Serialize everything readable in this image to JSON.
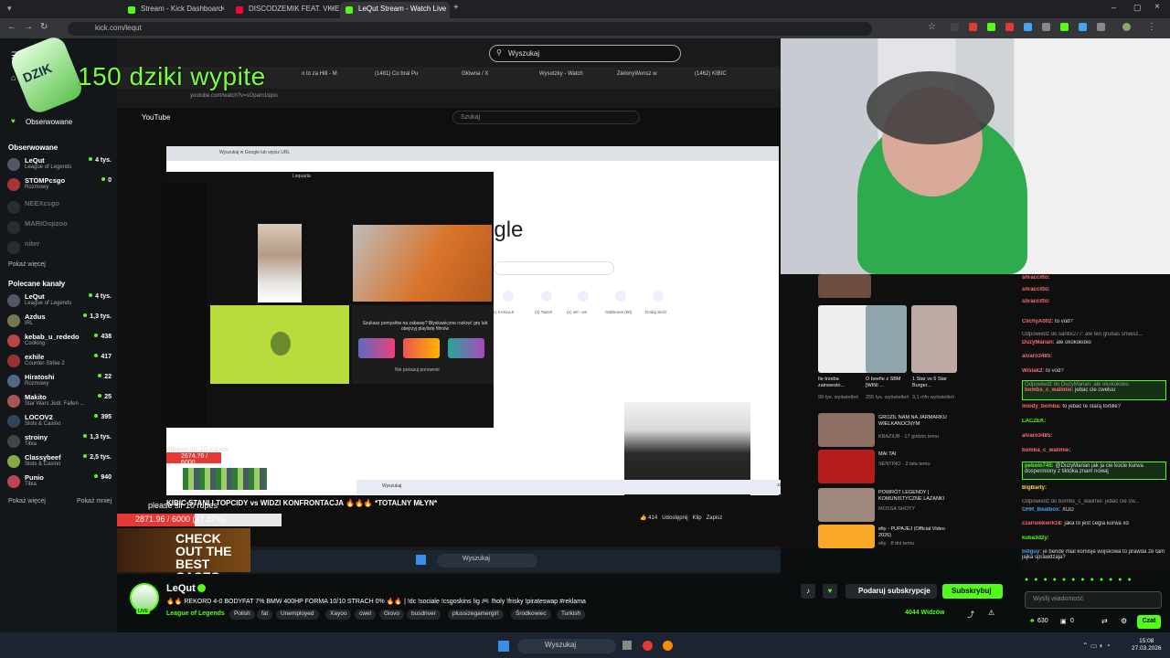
{
  "browser": {
    "tabs": [
      {
        "label": "Stream - Kick Dashboard",
        "favicon": "kick"
      },
      {
        "label": "DISCODZEMIK FEAT. VKIE, OK!",
        "favicon": "youtube"
      },
      {
        "label": "LeQut Stream - Watch Live",
        "favicon": "kick",
        "active": true
      }
    ],
    "url": "kick.com/lequt"
  },
  "sidebar": {
    "followed_top": "Obserwowane",
    "section_followed": "Obserwowane",
    "followed": [
      {
        "name": "LeQut",
        "category": "League of Legends",
        "viewers": "4 tys."
      },
      {
        "name": "STOMPcsgo",
        "category": "Rozmowy",
        "viewers": "0"
      },
      {
        "name": "NEEXcsgo",
        "category": "",
        "viewers": ""
      },
      {
        "name": "MARIOspzoo",
        "category": "",
        "viewers": ""
      },
      {
        "name": "niter",
        "category": "",
        "viewers": ""
      }
    ],
    "show_more": "Pokaż więcej",
    "section_recommended": "Polecane kanały",
    "recommended": [
      {
        "name": "LeQut",
        "category": "League of Legends",
        "viewers": "4 tys."
      },
      {
        "name": "Azdus",
        "category": "IRL",
        "viewers": "1,3 tys."
      },
      {
        "name": "kebab_u_rededo",
        "category": "Cooking",
        "viewers": "438"
      },
      {
        "name": "exhile",
        "category": "Counter-Strike 2",
        "viewers": "417"
      },
      {
        "name": "Hiratoshi",
        "category": "Rozmowy",
        "viewers": "22"
      },
      {
        "name": "Makito",
        "category": "Star Wars Jedi: Fallen ...",
        "viewers": "25"
      },
      {
        "name": "LOCOV2",
        "category": "Slots & Casino",
        "viewers": "395"
      },
      {
        "name": "stroiny",
        "category": "Tibia",
        "viewers": "1,3 tys."
      },
      {
        "name": "Classybeef",
        "category": "Slots & Casino",
        "viewers": "2,5 tys."
      },
      {
        "name": "Punio",
        "category": "Tibia",
        "viewers": "940"
      }
    ],
    "show_more2": "Pokaż więcej",
    "show_less": "Pokaż mniej"
  },
  "video": {
    "search_placeholder": "Wyszukaj",
    "overlay_text": "150  dziki wypite",
    "can_label": "DZIK",
    "inner_tabs": [
      "o to za Hitl - M",
      "(1481) Co bral Pu",
      "Główna / X",
      "Wysotzky - Watch",
      "ZielonyWonsz w",
      "(1462) KIBIC"
    ],
    "inner_url": "youtube.com/watch?v=sOpam1tqoo",
    "yt_logo": "YouTube",
    "yt_search": "Szukaj",
    "google_url_bar": "Wyszukaj w Google lub wpisz URL",
    "google_text": "ogle",
    "google_shortcuts": [
      "(1) KANALE",
      "(3) Twitch",
      "(1) intl - wn",
      "Odebrane (80)",
      "Dodaj skrót"
    ],
    "call_window_title": "Lequarta",
    "popup_text": "Szukasz pomysłów na zabawę? Błyskawiczne rozkręć grę lub obejrzyj playlistę filmów",
    "popup_checkbox": "Nie pokazuj ponownie",
    "donate_label_1": "please sir 10 rupes",
    "donate_amount_1": "2674.76 / 6000 (44.58%)",
    "yt_video_title": "KIBIC STANI I TOPCIDY vs WIDZI KONFRONTACJA 🔥🔥🔥 *TOTALNY MŁYN*",
    "donate_label_2": "please sir 10 rupes",
    "donate_amount_2": "2871.96 / 6000 (47.87%)",
    "yt_actions": [
      "414",
      "Udostępnij",
      "Klip",
      "Zapisz"
    ],
    "promo_text": "CHECK OUT THE BEST CASES",
    "inner_taskbar_search": "Wyszukaj",
    "inner_clock": "15:08 27.03.2026"
  },
  "right_panel": {
    "videos": [
      {
        "title": "Ile trzeba zainwesto...",
        "meta": "99 tys. wyświetleń"
      },
      {
        "title": "O beefie z SBM [WINI ...",
        "meta": "255 tys. wyświetleń"
      },
      {
        "title": "1 Star vs 5 Star Burger...",
        "meta": "3,1 mln wyświetleń"
      },
      {
        "title": "GROZIL NAM NA JARMARKU WIELKANOCNYM",
        "meta": "KBAZIUB · 17 godzin temu"
      },
      {
        "title": "MAI TAI",
        "meta": "SENTINO · 2 lata temu"
      },
      {
        "title": "POWRÓT LEGENDY | KOMUNISTYCZNE LAZANKI",
        "meta": "MOSSA SHOTY"
      },
      {
        "title": "elty - PUPAJEJ (Official Video 2026)",
        "meta": "elty · 8 dni temu"
      }
    ]
  },
  "chat": {
    "messages": [
      {
        "user": "shraccitto:",
        "text": ""
      },
      {
        "user": "shraccitto:",
        "text": ""
      },
      {
        "user": "shraccitto:",
        "text": ""
      },
      {
        "user": "ClichyA002:",
        "text": "to vod?"
      },
      {
        "user": "",
        "text": "Odpowiedź do santix277: ale ten grubas smiesz..."
      },
      {
        "user": "DuzyMarian:",
        "text": "ale okokokoko"
      },
      {
        "user": "alvaro3485:",
        "text": ""
      },
      {
        "user": "Wiślak2:",
        "text": "to vod?"
      },
      {
        "user": "",
        "text": "Odpowiedź do DuzyMarian: ale okokokoko",
        "highlight": true
      },
      {
        "user": "bombs_c_walimie:",
        "text": "jebac cie cweluu",
        "highlight": true
      },
      {
        "user": "mlody_bomba:",
        "text": "to jebać te starą tortille?"
      },
      {
        "user": "LACZEK:",
        "text": ""
      },
      {
        "user": "alvaro3485:",
        "text": ""
      },
      {
        "user": "bomba_c_walimie:",
        "text": ""
      },
      {
        "user": "pebolo745:",
        "text": "@DuzyMarian jak ja cie kocie kurwa dospermiony z tiktoka znam nowaj",
        "highlight": true
      },
      {
        "user": "BigBarty:",
        "text": ""
      },
      {
        "user": "",
        "text": "Odpowiedź do bombs_c_walimie: jebac cie cw..."
      },
      {
        "user": "GHR_Beatbox:",
        "text": "XDD"
      },
      {
        "user": "czarislekierk18:",
        "text": "jaka to jest cegla kurwa xd"
      },
      {
        "user": "kuba3d2y:",
        "text": ""
      },
      {
        "user": "billguy:",
        "text": "je bende mial komisje wojskowa to prawda ze tam jajka sprawdzaja?"
      }
    ],
    "input_placeholder": "Wyślij wiadomość",
    "points": "630",
    "coins": "0",
    "send_label": "Czat"
  },
  "stream": {
    "streamer": "LeQut",
    "title": "🔥🔥 REKORD 4-0 BODYFAT 7% BMW 400HP FORMA 10/10 STRACH 0% 🔥🔥 | !dc !sociale !csgoskins !ig 🎮 !holy !frisky !pirateswap #reklama",
    "category": "League of Legends",
    "tags": [
      "Polish",
      "fat",
      "Unemployed",
      "Xayoo",
      "cwel",
      "Glovo",
      "busdriver",
      "plussizegamergirl",
      "Środkowiec",
      "Turkish"
    ],
    "gift_button": "Podaruj subskrypcje",
    "subscribe_button": "Subskrybuj",
    "viewers": "4044 Widzów"
  },
  "taskbar": {
    "search": "Wyszukaj",
    "time": "15:08",
    "date": "27.03.2026"
  },
  "colors": {
    "kick_green": "#53fc18",
    "background": "#0b0e0f",
    "sidebar": "#141719"
  }
}
